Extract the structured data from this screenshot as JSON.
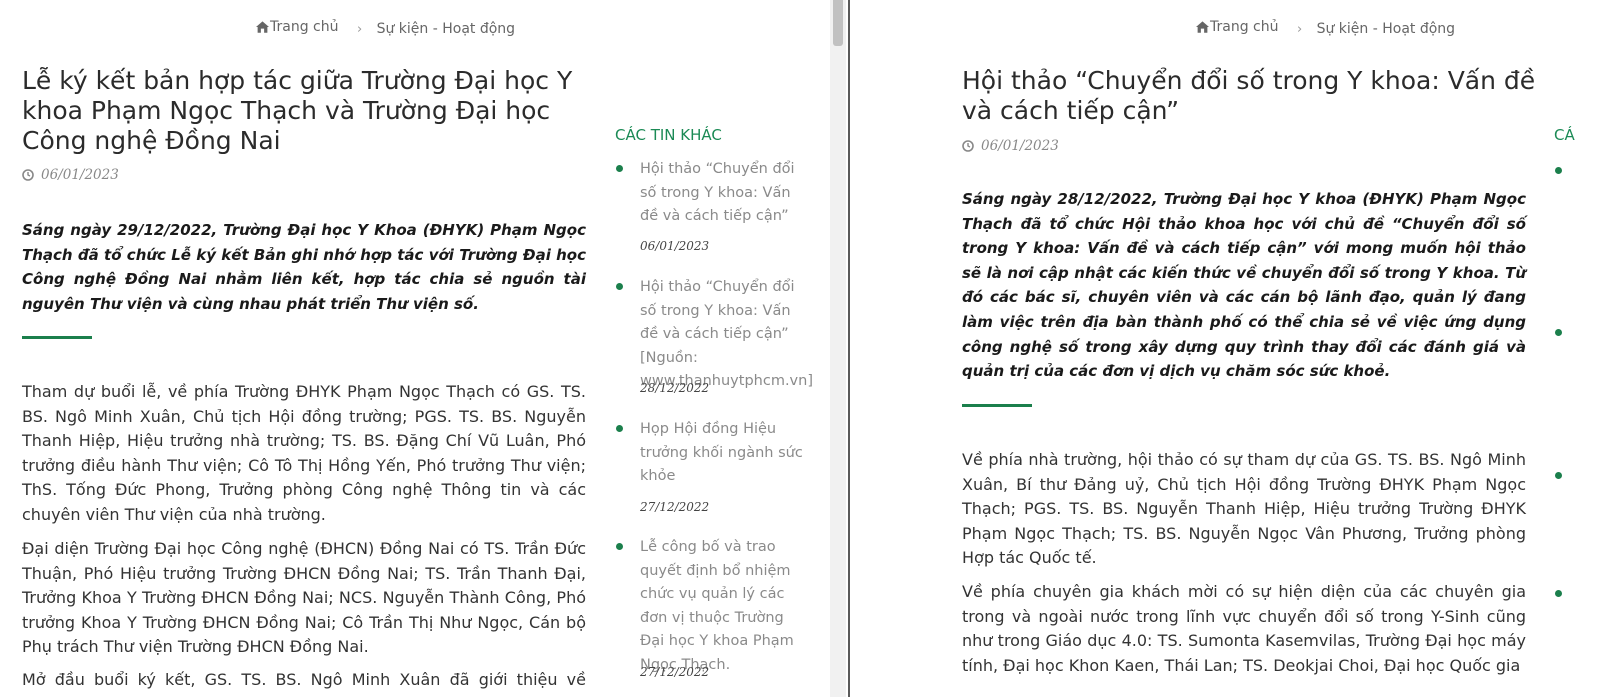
{
  "left": {
    "breadcrumb": {
      "home": "Trang chủ",
      "current": "Sự kiện - Hoạt động"
    },
    "title": "Lễ ký kết bản hợp tác giữa Trường Đại học Y khoa Phạm Ngọc Thạch và Trường Đại học Công nghệ Đồng Nai",
    "date": "06/01/2023",
    "lead": "Sáng ngày 29/12/2022, Trường Đại học Y Khoa (ĐHYK) Phạm Ngọc Thạch đã tổ chức Lễ ký kết Bản ghi nhớ hợp tác với Trường Đại học Công nghệ Đồng Nai nhằm liên kết, hợp tác chia sẻ nguồn tài nguyên Thư viện và cùng nhau phát triển Thư viện số.",
    "paragraphs": [
      "Tham dự buổi lễ, về phía Trường ĐHYK Phạm Ngọc Thạch có GS. TS. BS. Ngô Minh Xuân, Chủ tịch Hội đồng trường; PGS. TS. BS. Nguyễn Thanh Hiệp, Hiệu trưởng nhà trường; TS. BS. Đặng Chí Vũ Luân, Phó trưởng điều hành Thư viện; Cô Tô Thị Hồng Yến, Phó trưởng Thư viện; ThS. Tống Đức Phong, Trưởng phòng Công nghệ Thông tin và các chuyên viên Thư viện của nhà trường.",
      "Đại diện Trường Đại học Công nghệ (ĐHCN) Đồng Nai có TS. Trần Đức Thuận, Phó Hiệu trưởng Trường ĐHCN Đồng Nai; TS. Trần Thanh Đại, Trưởng Khoa Y Trường ĐHCN Đồng Nai; NCS. Nguyễn Thành Công, Phó trưởng Khoa Y Trường ĐHCN Đồng Nai; Cô Trần Thị Như Ngọc, Cán bộ Phụ trách Thư viện Trường ĐHCN Đồng Nai.",
      "Mở đầu buổi ký kết, GS. TS. BS. Ngô Minh Xuân đã giới thiệu về Trường"
    ],
    "sidebar": {
      "heading": "CÁC TIN KHÁC",
      "items": [
        {
          "title": "Hội thảo “Chuyển đổi số trong Y khoa: Vấn đề và cách tiếp cận”",
          "date": "06/01/2023"
        },
        {
          "title": "Hội thảo “Chuyển đổi số trong Y khoa: Vấn đề và cách tiếp cận” [Nguồn: www.thanhuytphcm.vn]",
          "date": "28/12/2022"
        },
        {
          "title": "Họp Hội đồng Hiệu trưởng khối ngành sức khỏe",
          "date": "27/12/2022"
        },
        {
          "title": "Lễ công bố và trao quyết định bổ nhiệm chức vụ quản lý các đơn vị thuộc Trường Đại học Y khoa Phạm Ngọc Thạch.",
          "date": "27/12/2022"
        }
      ]
    }
  },
  "right": {
    "breadcrumb": {
      "home": "Trang chủ",
      "current": "Sự kiện - Hoạt động"
    },
    "title": "Hội thảo “Chuyển đổi số trong Y khoa: Vấn đề và cách tiếp cận”",
    "date": "06/01/2023",
    "lead": "Sáng ngày 28/12/2022, Trường Đại học Y khoa (ĐHYK) Phạm Ngọc Thạch đã tổ chức Hội thảo khoa học với chủ đề “Chuyển đổi số trong Y khoa: Vấn đề và cách tiếp cận” với mong muốn hội thảo sẽ là nơi cập nhật các kiến thức về chuyển đổi số trong Y khoa. Từ đó các bác sĩ, chuyên viên và các cán bộ lãnh đạo, quản lý đang làm việc trên địa bàn thành phố có thể chia sẻ về việc ứng dụng công nghệ số trong xây dựng quy trình thay đổi các đánh giá và quản trị của các đơn vị dịch vụ chăm sóc sức khoẻ.",
    "paragraphs": [
      "Về phía nhà trường, hội thảo có sự tham dự của GS. TS. BS. Ngô Minh Xuân, Bí thư Đảng uỷ, Chủ tịch Hội đồng Trường ĐHYK Phạm Ngọc Thạch; PGS. TS. BS. Nguyễn Thanh Hiệp, Hiệu trưởng Trường ĐHYK Phạm Ngọc Thạch; TS. BS. Nguyễn Ngọc Vân Phương, Trưởng phòng Hợp tác Quốc tế.",
      "Về phía chuyên gia khách mời có sự hiện diện của các chuyên gia trong và ngoài nước trong lĩnh vực chuyển đổi số trong Y-Sinh cũng như trong Giáo dục 4.0: TS. Sumonta Kasemvilas, Trường Đại học máy tính, Đại học Khon Kaen, Thái Lan; TS. Deokjai Choi, Đại học Quốc gia"
    ],
    "sidebar_heading_partial": "CÁ"
  },
  "colors": {
    "accent": "#1b7f4c",
    "heading_green": "#1b8a55",
    "muted": "#8a8a8a"
  }
}
